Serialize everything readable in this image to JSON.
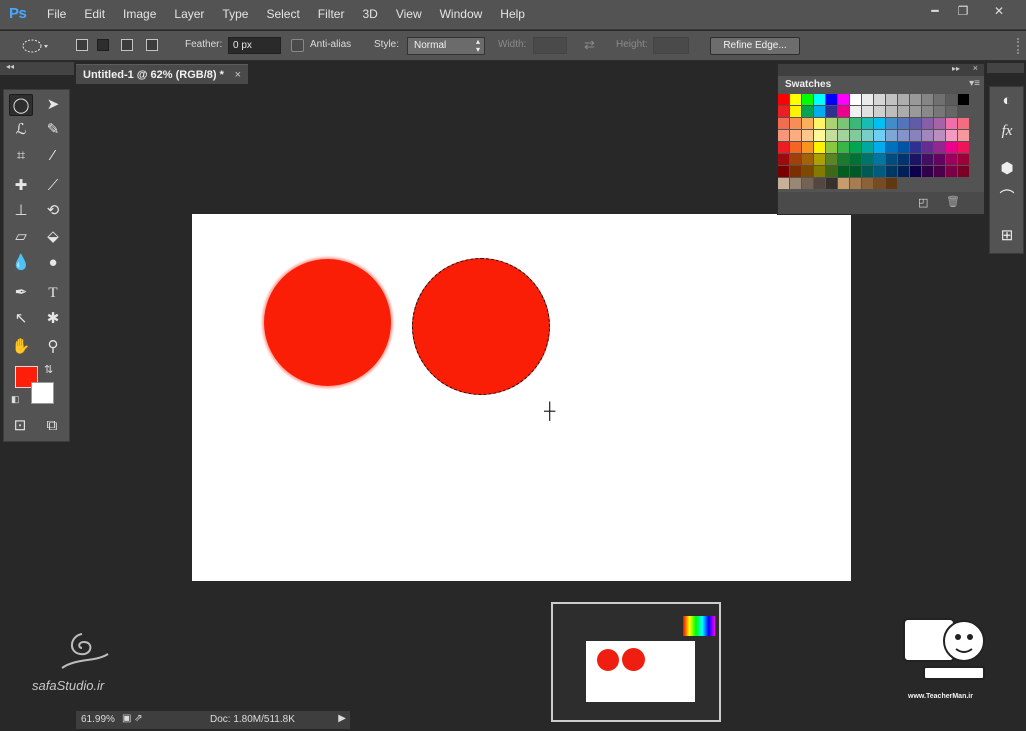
{
  "app": {
    "logo": "Ps"
  },
  "menu": [
    "File",
    "Edit",
    "Image",
    "Layer",
    "Type",
    "Select",
    "Filter",
    "3D",
    "View",
    "Window",
    "Help"
  ],
  "window_controls": {
    "minimize": "━",
    "maximize": "❐",
    "close": "✕"
  },
  "options_bar": {
    "feather_label": "Feather:",
    "feather_value": "0 px",
    "antialias_label": "Anti-alias",
    "style_label": "Style:",
    "style_value": "Normal",
    "width_label": "Width:",
    "height_label": "Height:",
    "refine_edge_label": "Refine Edge..."
  },
  "document": {
    "tab_title": "Untitled-1 @ 62% (RGB/8) *",
    "close": "×"
  },
  "status_bar": {
    "zoom": "61.99%",
    "doc_info": "Doc: 1.80M/511.8K"
  },
  "colors": {
    "foreground": "#ff1e0a",
    "background": "#ffffff",
    "circle_fill": "#fb1e07"
  },
  "swatches_panel": {
    "title": "Swatches",
    "colors": [
      "#ff0000",
      "#ffff00",
      "#00ff00",
      "#00ffff",
      "#0000ff",
      "#ff00ff",
      "#ffffff",
      "#ebebeb",
      "#d6d6d6",
      "#c2c2c2",
      "#adadad",
      "#999999",
      "#858585",
      "#707070",
      "#5c5c5c",
      "#000000",
      "#ee1d24",
      "#fff200",
      "#00a650",
      "#00aeef",
      "#2e3192",
      "#ec008c",
      "#f1f1f1",
      "#e0e0e0",
      "#cfcfcf",
      "#bdbdbd",
      "#acacac",
      "#9a9a9a",
      "#898989",
      "#777777",
      "#666666",
      "#545454",
      "#f26c4f",
      "#f68e55",
      "#fbaf5c",
      "#fff467",
      "#acd372",
      "#7cc576",
      "#3bb878",
      "#1abbb4",
      "#00bff3",
      "#438cca",
      "#5574b9",
      "#605ca8",
      "#855fa8",
      "#a763a8",
      "#f06ea9",
      "#f26d7d",
      "#f7977a",
      "#f9ad81",
      "#fdc68a",
      "#fff79a",
      "#c4df9b",
      "#a2d39c",
      "#82ca9d",
      "#7bcdc8",
      "#6ecff6",
      "#7ea7d8",
      "#8493ca",
      "#8882be",
      "#a187be",
      "#bc8dbf",
      "#f49ac2",
      "#f6989d",
      "#ed1c24",
      "#f26522",
      "#f7941d",
      "#fff200",
      "#8dc63f",
      "#39b54a",
      "#00a651",
      "#00a99d",
      "#00aeef",
      "#0072bc",
      "#0054a6",
      "#2e3192",
      "#662d91",
      "#92278f",
      "#ec008c",
      "#ed145b",
      "#9e0b0f",
      "#a0410d",
      "#a36209",
      "#aba000",
      "#598527",
      "#1a7b30",
      "#007236",
      "#00746b",
      "#0076a3",
      "#004b80",
      "#003471",
      "#1b1464",
      "#440e62",
      "#630460",
      "#9e005d",
      "#9e0039",
      "#790000",
      "#7b2e00",
      "#7d4900",
      "#827b00",
      "#406618",
      "#005e20",
      "#005826",
      "#005952",
      "#005b7f",
      "#003663",
      "#002157",
      "#0d004c",
      "#32004b",
      "#4b0049",
      "#7b0046",
      "#7a0026",
      "#c7b299",
      "#998675",
      "#736357",
      "#534741",
      "#37302d",
      "#c69c6d",
      "#a67c52",
      "#8c6239",
      "#754c24",
      "#603913"
    ]
  },
  "tools": [
    "elliptical-marquee",
    "move",
    "lasso",
    "quick-selection",
    "crop",
    "eyedropper",
    "spot-healing-brush",
    "brush",
    "clone-stamp",
    "history-brush",
    "eraser",
    "paint-bucket",
    "blur",
    "dodge",
    "pen",
    "type",
    "path-selection",
    "custom-shape",
    "hand",
    "zoom"
  ],
  "watermarks": {
    "left_site": "safaStudio.ir",
    "right_url": "www.TeacherMan.ir"
  }
}
